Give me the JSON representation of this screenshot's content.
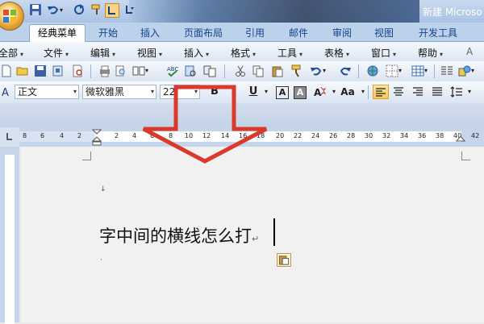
{
  "window": {
    "title": "新建 Microso"
  },
  "ribbon": {
    "tabs": [
      {
        "label": "经典菜单",
        "active": true
      },
      {
        "label": "开始"
      },
      {
        "label": "插入"
      },
      {
        "label": "页面布局"
      },
      {
        "label": "引用"
      },
      {
        "label": "邮件"
      },
      {
        "label": "审阅"
      },
      {
        "label": "视图"
      },
      {
        "label": "开发工具"
      }
    ]
  },
  "menubar": {
    "items": [
      "全部",
      "文件",
      "编辑",
      "视图",
      "插入",
      "格式",
      "工具",
      "表格",
      "窗口",
      "帮助"
    ]
  },
  "format_toolbar": {
    "style": "正文",
    "font": "微软雅黑",
    "size": "22",
    "bold": "B",
    "italic": "I",
    "underline": "U",
    "char_border": "A",
    "char_shade": "A",
    "text_effect": "Aa"
  },
  "ruler": {
    "numbers": [
      "8",
      "6",
      "4",
      "2",
      "2",
      "4",
      "6",
      "8",
      "10",
      "12",
      "14",
      "16",
      "18",
      "20",
      "22",
      "24",
      "26",
      "28",
      "30",
      "32",
      "34",
      "36",
      "38",
      "40",
      "42"
    ]
  },
  "document": {
    "paragraph_mark": "↓",
    "text_line": "字中间的横线怎么打",
    "line_end_mark": "↵",
    "trailing_mark": "·"
  },
  "colors": {
    "arrow": "#d93a2b",
    "tab_text": "#15428b",
    "ribbon": "#bcd1ea"
  }
}
